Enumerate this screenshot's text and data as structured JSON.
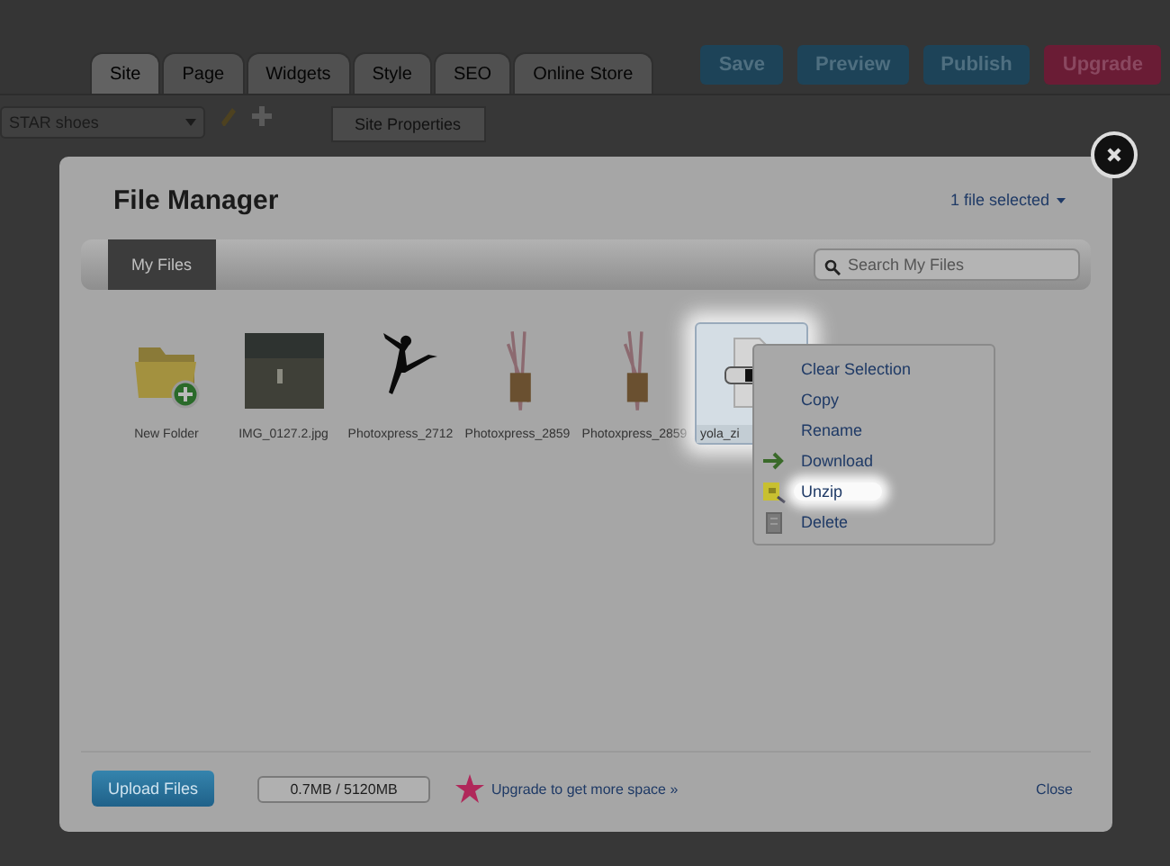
{
  "app": {
    "tabs": [
      {
        "label": "Site",
        "selected": true
      },
      {
        "label": "Page",
        "selected": false
      },
      {
        "label": "Widgets",
        "selected": false
      },
      {
        "label": "Style",
        "selected": false
      },
      {
        "label": "SEO",
        "selected": false
      },
      {
        "label": "Online Store",
        "selected": false
      }
    ],
    "actions": [
      {
        "label": "Save",
        "kind": "primary"
      },
      {
        "label": "Preview",
        "kind": "primary"
      },
      {
        "label": "Publish",
        "kind": "primary"
      },
      {
        "label": "Upgrade",
        "kind": "accent"
      }
    ],
    "site_select": {
      "value": "STAR shoes"
    },
    "panel": {
      "items": [
        "Site Properties"
      ]
    }
  },
  "dialog": {
    "title": "File Manager",
    "selection": "1 file selected",
    "tab": {
      "label": "My Files",
      "selected": true
    },
    "search": {
      "placeholder": "Search My Files"
    },
    "files": [
      {
        "name": "New Folder",
        "kind": "folder",
        "selected": false
      },
      {
        "name": "IMG_0127.2.jpg",
        "kind": "photo",
        "selected": false
      },
      {
        "name": "Photoxpress_2712",
        "kind": "silhouette",
        "selected": false
      },
      {
        "name": "Photoxpress_2859",
        "kind": "sketch",
        "selected": false
      },
      {
        "name": "Photoxpress_2859",
        "kind": "sketch",
        "selected": false
      },
      {
        "name": "yola_zi",
        "kind": "zip",
        "selected": true
      }
    ],
    "menu": [
      {
        "label": "Clear Selection",
        "kind": "plain",
        "highlighted": false
      },
      {
        "label": "Copy",
        "kind": "plain",
        "highlighted": false
      },
      {
        "label": "Rename",
        "kind": "plain",
        "highlighted": false
      },
      {
        "label": "Download",
        "kind": "download",
        "highlighted": false
      },
      {
        "label": "Unzip",
        "kind": "unzip",
        "highlighted": true
      },
      {
        "label": "Delete",
        "kind": "delete",
        "highlighted": false
      }
    ],
    "footer": {
      "upload": "Upload Files",
      "usage": "0.7MB / 5120MB",
      "upgrade": "Upgrade to get more space »",
      "close": "Close"
    }
  }
}
